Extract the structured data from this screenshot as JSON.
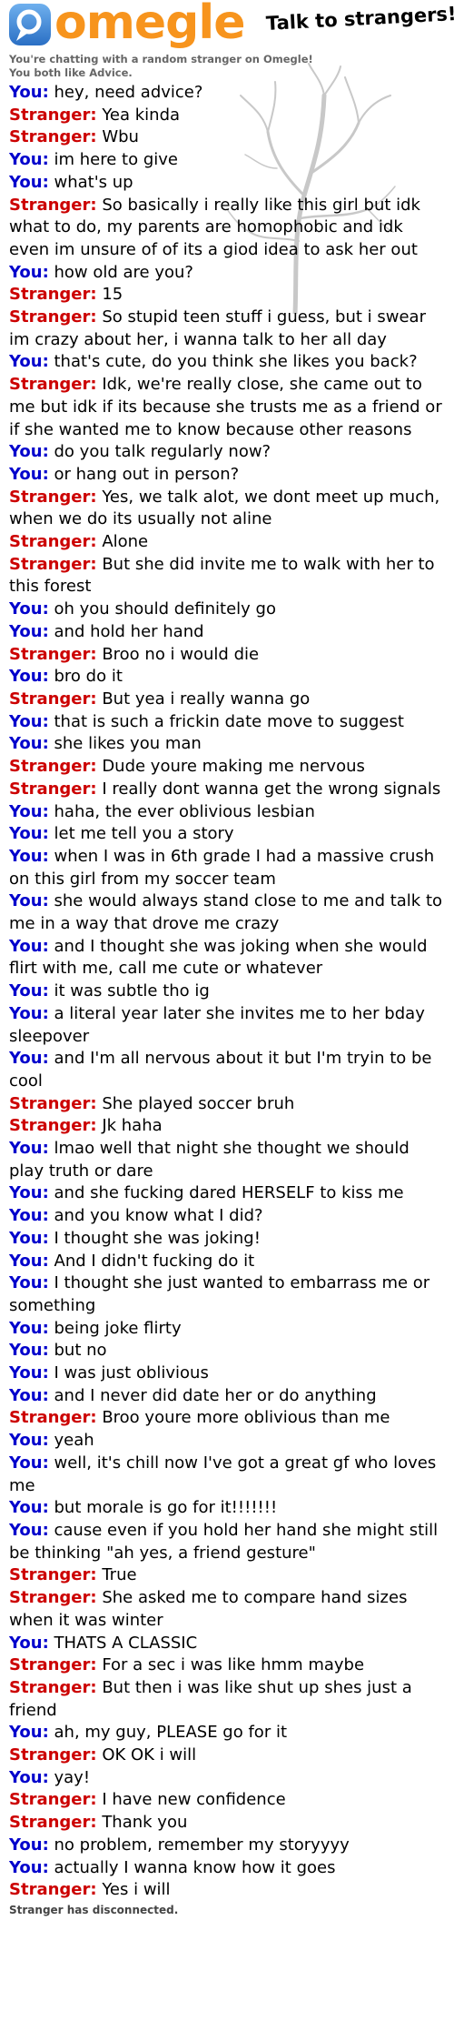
{
  "header": {
    "logo_text": "omegle",
    "tagline": "Talk to strangers!",
    "brand_color": "#f7941d",
    "logo_icon": "omegle-logo-icon"
  },
  "status": {
    "chat_info": "You're chatting with a random stranger on Omegle!",
    "likes": "You both like Advice.",
    "disconnected": "Stranger has disconnected."
  },
  "colors": {
    "you": "#0000cc",
    "stranger": "#cc0000"
  },
  "messages": [
    {
      "speaker": "You:",
      "role": "you",
      "text": "hey, need advice?"
    },
    {
      "speaker": "Stranger:",
      "role": "stranger",
      "text": "Yea kinda"
    },
    {
      "speaker": "Stranger:",
      "role": "stranger",
      "text": "Wbu"
    },
    {
      "speaker": "You:",
      "role": "you",
      "text": "im here to give"
    },
    {
      "speaker": "You:",
      "role": "you",
      "text": "what's up"
    },
    {
      "speaker": "Stranger:",
      "role": "stranger",
      "text": "So basically i really like this girl but idk what to do, my parents are homophobic and idk even im unsure of of its a giod idea to ask her out"
    },
    {
      "speaker": "You:",
      "role": "you",
      "text": "how old are you?"
    },
    {
      "speaker": "Stranger:",
      "role": "stranger",
      "text": "15"
    },
    {
      "speaker": "Stranger:",
      "role": "stranger",
      "text": "So stupid teen stuff i guess, but i swear im crazy about her, i wanna talk to her all day"
    },
    {
      "speaker": "You:",
      "role": "you",
      "text": "that's cute, do you think she likes you back?"
    },
    {
      "speaker": "Stranger:",
      "role": "stranger",
      "text": "Idk, we're really close, she came out to me but idk if its because she trusts me as a friend or if she wanted me to know because other reasons"
    },
    {
      "speaker": "You:",
      "role": "you",
      "text": "do you talk regularly now?"
    },
    {
      "speaker": "You:",
      "role": "you",
      "text": "or hang out in person?"
    },
    {
      "speaker": "Stranger:",
      "role": "stranger",
      "text": "Yes, we talk alot, we dont meet up much, when we do its usually not aline"
    },
    {
      "speaker": "Stranger:",
      "role": "stranger",
      "text": "Alone"
    },
    {
      "speaker": "Stranger:",
      "role": "stranger",
      "text": "But she did invite me to walk with her to this forest"
    },
    {
      "speaker": "You:",
      "role": "you",
      "text": "oh you should definitely go"
    },
    {
      "speaker": "You:",
      "role": "you",
      "text": "and hold her hand"
    },
    {
      "speaker": "Stranger:",
      "role": "stranger",
      "text": "Broo no i would die"
    },
    {
      "speaker": "You:",
      "role": "you",
      "text": "bro do it"
    },
    {
      "speaker": "Stranger:",
      "role": "stranger",
      "text": "But yea i really wanna go"
    },
    {
      "speaker": "You:",
      "role": "you",
      "text": "that is such a frickin date move to suggest"
    },
    {
      "speaker": "You:",
      "role": "you",
      "text": "she likes you man"
    },
    {
      "speaker": "Stranger:",
      "role": "stranger",
      "text": "Dude youre making me nervous"
    },
    {
      "speaker": "Stranger:",
      "role": "stranger",
      "text": "I really dont wanna get the wrong signals"
    },
    {
      "speaker": "You:",
      "role": "you",
      "text": "haha, the ever oblivious lesbian"
    },
    {
      "speaker": "You:",
      "role": "you",
      "text": "let me tell you a story"
    },
    {
      "speaker": "You:",
      "role": "you",
      "text": "when I was in 6th grade I had a massive crush on this girl from my soccer team"
    },
    {
      "speaker": "You:",
      "role": "you",
      "text": "she would always stand close to me and talk to me in a way that drove me crazy"
    },
    {
      "speaker": "You:",
      "role": "you",
      "text": "and I thought she was joking when she would flirt with me, call me cute or whatever"
    },
    {
      "speaker": "You:",
      "role": "you",
      "text": "it was subtle tho ig"
    },
    {
      "speaker": "You:",
      "role": "you",
      "text": "a literal year later she invites me to her bday sleepover"
    },
    {
      "speaker": "You:",
      "role": "you",
      "text": "and I'm all nervous about it but I'm tryin to be cool"
    },
    {
      "speaker": "Stranger:",
      "role": "stranger",
      "text": "She played soccer bruh"
    },
    {
      "speaker": "Stranger:",
      "role": "stranger",
      "text": "Jk haha"
    },
    {
      "speaker": "You:",
      "role": "you",
      "text": "lmao well that night she thought we should play truth or dare"
    },
    {
      "speaker": "You:",
      "role": "you",
      "text": "and she fucking dared HERSELF to kiss me"
    },
    {
      "speaker": "You:",
      "role": "you",
      "text": "and you know what I did?"
    },
    {
      "speaker": "You:",
      "role": "you",
      "text": "I thought she was joking!"
    },
    {
      "speaker": "You:",
      "role": "you",
      "text": "And I didn't fucking do it"
    },
    {
      "speaker": "You:",
      "role": "you",
      "text": "I thought she just wanted to embarrass me or something"
    },
    {
      "speaker": "You:",
      "role": "you",
      "text": "being joke flirty"
    },
    {
      "speaker": "You:",
      "role": "you",
      "text": "but no"
    },
    {
      "speaker": "You:",
      "role": "you",
      "text": "I was just oblivious"
    },
    {
      "speaker": "You:",
      "role": "you",
      "text": "and I never did date her or do anything"
    },
    {
      "speaker": "Stranger:",
      "role": "stranger",
      "text": "Broo youre more oblivious than me"
    },
    {
      "speaker": "You:",
      "role": "you",
      "text": "yeah"
    },
    {
      "speaker": "You:",
      "role": "you",
      "text": "well, it's chill now I've got a great gf who loves me"
    },
    {
      "speaker": "You:",
      "role": "you",
      "text": "but morale is go for it!!!!!!!"
    },
    {
      "speaker": "You:",
      "role": "you",
      "text": "cause even if you hold her hand she might still be thinking \"ah yes, a friend gesture\""
    },
    {
      "speaker": "Stranger:",
      "role": "stranger",
      "text": "True"
    },
    {
      "speaker": "Stranger:",
      "role": "stranger",
      "text": "She asked me to compare hand sizes when it was winter"
    },
    {
      "speaker": "You:",
      "role": "you",
      "text": "THATS A CLASSIC"
    },
    {
      "speaker": "Stranger:",
      "role": "stranger",
      "text": "For a sec i was like hmm maybe"
    },
    {
      "speaker": "Stranger:",
      "role": "stranger",
      "text": "But then i was like shut up shes just a friend"
    },
    {
      "speaker": "You:",
      "role": "you",
      "text": "ah, my guy, PLEASE go for it"
    },
    {
      "speaker": "Stranger:",
      "role": "stranger",
      "text": "OK OK i will"
    },
    {
      "speaker": "You:",
      "role": "you",
      "text": "yay!"
    },
    {
      "speaker": "Stranger:",
      "role": "stranger",
      "text": "I have new confidence"
    },
    {
      "speaker": "Stranger:",
      "role": "stranger",
      "text": "Thank you"
    },
    {
      "speaker": "You:",
      "role": "you",
      "text": "no problem, remember my storyyyy"
    },
    {
      "speaker": "You:",
      "role": "you",
      "text": "actually I wanna know how it goes"
    },
    {
      "speaker": "Stranger:",
      "role": "stranger",
      "text": "Yes i will"
    }
  ]
}
